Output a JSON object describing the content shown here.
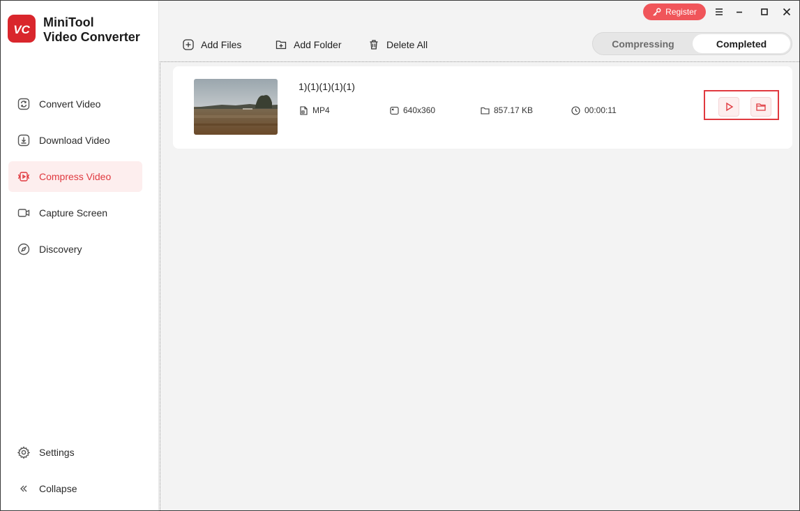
{
  "app": {
    "name_line1": "MiniTool",
    "name_line2": "Video Converter"
  },
  "sidebar": {
    "items": [
      {
        "label": "Convert Video",
        "icon": "convert-icon"
      },
      {
        "label": "Download Video",
        "icon": "download-icon"
      },
      {
        "label": "Compress Video",
        "icon": "compress-icon",
        "active": true
      },
      {
        "label": "Capture Screen",
        "icon": "camera-icon"
      },
      {
        "label": "Discovery",
        "icon": "compass-icon"
      }
    ],
    "bottom": [
      {
        "label": "Settings",
        "icon": "gear-icon"
      },
      {
        "label": "Collapse",
        "icon": "double-chevron-left-icon"
      }
    ]
  },
  "header": {
    "register_label": "Register",
    "window_controls": [
      "menu-icon",
      "minimize-icon",
      "maximize-icon",
      "close-icon"
    ]
  },
  "toolbar": {
    "add_files": "Add Files",
    "add_folder": "Add Folder",
    "delete_all": "Delete All"
  },
  "tabs": {
    "compressing": "Compressing",
    "completed": "Completed",
    "selected": "Completed"
  },
  "files": [
    {
      "name": "1)(1)(1)(1)(1)",
      "format": "MP4",
      "resolution": "640x360",
      "size": "857.17 KB",
      "duration": "00:00:11"
    }
  ],
  "colors": {
    "accent": "#e0393f",
    "register_bg": "#f0555a",
    "active_bg": "#fdeeee"
  }
}
